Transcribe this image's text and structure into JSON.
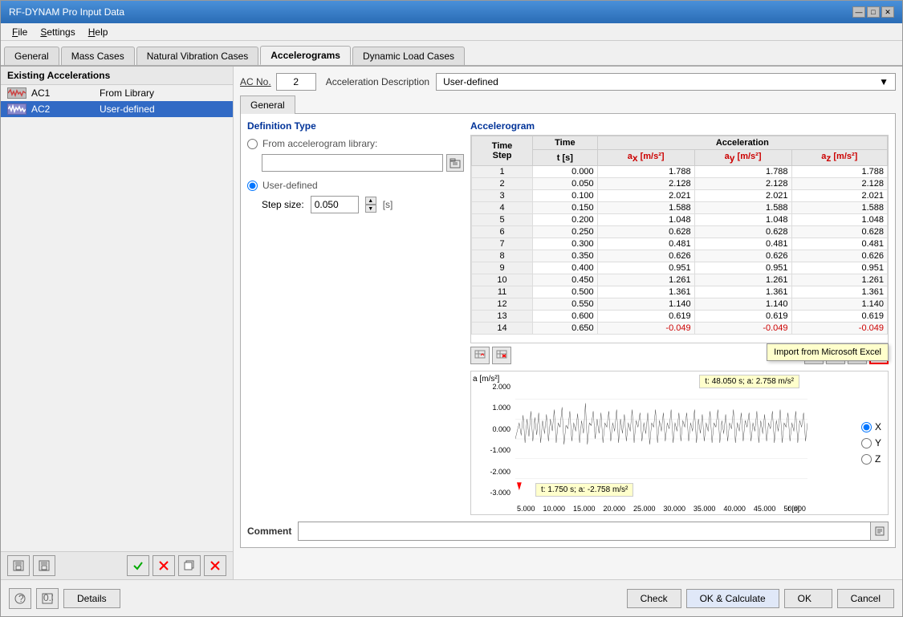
{
  "window": {
    "title": "RF-DYNAM Pro Input Data",
    "close_btn": "✕",
    "min_btn": "—",
    "max_btn": "□"
  },
  "menu": {
    "items": [
      "File",
      "Settings",
      "Help"
    ]
  },
  "tabs": [
    {
      "label": "General",
      "active": false
    },
    {
      "label": "Mass Cases",
      "active": false
    },
    {
      "label": "Natural Vibration Cases",
      "active": false
    },
    {
      "label": "Accelerograms",
      "active": true
    },
    {
      "label": "Dynamic Load Cases",
      "active": false
    }
  ],
  "left_panel": {
    "header": "Existing Accelerations",
    "items": [
      {
        "id": "AC1",
        "desc": "From Library",
        "selected": false
      },
      {
        "id": "AC2",
        "desc": "User-defined",
        "selected": true
      }
    ]
  },
  "ac_no": {
    "label": "AC No.",
    "value": "2"
  },
  "acc_description": {
    "label": "Acceleration Description",
    "value": "User-defined",
    "options": [
      "User-defined",
      "From Library"
    ]
  },
  "general_tab": {
    "label": "General"
  },
  "definition_type": {
    "title": "Definition Type",
    "library_label": "From accelerogram library:",
    "user_label": "User-defined",
    "step_label": "Step size:",
    "step_value": "0.050",
    "step_unit": "[s]"
  },
  "accelerogram": {
    "title": "Accelerogram",
    "columns": {
      "step": "Time Step",
      "time_label": "Time",
      "time_unit": "t [s]",
      "ax_label": "Acceleration",
      "ax_unit": "ax [m/s²]",
      "ay_unit": "ay [m/s²]",
      "az_unit": "az [m/s²]"
    },
    "rows": [
      {
        "step": 1,
        "time": "0.000",
        "ax": "1.788",
        "ay": "1.788",
        "az": "1.788"
      },
      {
        "step": 2,
        "time": "0.050",
        "ax": "2.128",
        "ay": "2.128",
        "az": "2.128"
      },
      {
        "step": 3,
        "time": "0.100",
        "ax": "2.021",
        "ay": "2.021",
        "az": "2.021"
      },
      {
        "step": 4,
        "time": "0.150",
        "ax": "1.588",
        "ay": "1.588",
        "az": "1.588"
      },
      {
        "step": 5,
        "time": "0.200",
        "ax": "1.048",
        "ay": "1.048",
        "az": "1.048"
      },
      {
        "step": 6,
        "time": "0.250",
        "ax": "0.628",
        "ay": "0.628",
        "az": "0.628"
      },
      {
        "step": 7,
        "time": "0.300",
        "ax": "0.481",
        "ay": "0.481",
        "az": "0.481"
      },
      {
        "step": 8,
        "time": "0.350",
        "ax": "0.626",
        "ay": "0.626",
        "az": "0.626"
      },
      {
        "step": 9,
        "time": "0.400",
        "ax": "0.951",
        "ay": "0.951",
        "az": "0.951"
      },
      {
        "step": 10,
        "time": "0.450",
        "ax": "1.261",
        "ay": "1.261",
        "az": "1.261"
      },
      {
        "step": 11,
        "time": "0.500",
        "ax": "1.361",
        "ay": "1.361",
        "az": "1.361"
      },
      {
        "step": 12,
        "time": "0.550",
        "ax": "1.140",
        "ay": "1.140",
        "az": "1.140"
      },
      {
        "step": 13,
        "time": "0.600",
        "ax": "0.619",
        "ay": "0.619",
        "az": "0.619"
      },
      {
        "step": 14,
        "time": "0.650",
        "ax": "-0.049",
        "ay": "-0.049",
        "az": "-0.049"
      }
    ]
  },
  "chart": {
    "y_label": "a [m/s²]",
    "x_label": "t [s]",
    "y_ticks": [
      "2.000",
      "1.000",
      "0.000",
      "-1.000",
      "-2.000",
      "-3.000"
    ],
    "x_ticks": [
      "5.000",
      "10.000",
      "15.000",
      "20.000",
      "25.000",
      "30.000",
      "35.000",
      "40.000",
      "45.000",
      "50.000"
    ],
    "tooltip1": "t: 48.050 s; a: 2.758 m/s²",
    "tooltip2": "t: 1.750 s; a: -2.758 m/s²",
    "xyz": {
      "x_selected": true,
      "y_label": "Y",
      "z_label": "Z"
    }
  },
  "tooltip_popup": "Import from Microsoft Excel",
  "comment": {
    "label": "Comment"
  },
  "bottom": {
    "check_label": "Check",
    "ok_calc_label": "OK & Calculate",
    "ok_label": "OK",
    "cancel_label": "Cancel",
    "details_label": "Details"
  }
}
